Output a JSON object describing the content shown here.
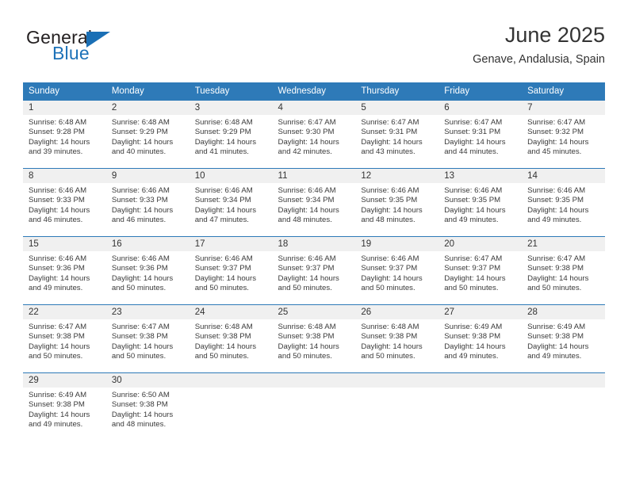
{
  "brand": {
    "name_part1": "General",
    "name_part2": "Blue",
    "accent_color": "#1a6fb5"
  },
  "header": {
    "title": "June 2025",
    "subtitle": "Genave, Andalusia, Spain"
  },
  "theme": {
    "header_blue": "#2e7ab8",
    "daynum_strip": "#f0f0f0",
    "text": "#333333"
  },
  "weekdays": [
    "Sunday",
    "Monday",
    "Tuesday",
    "Wednesday",
    "Thursday",
    "Friday",
    "Saturday"
  ],
  "weeks": [
    [
      {
        "day": "1",
        "sunrise": "Sunrise: 6:48 AM",
        "sunset": "Sunset: 9:28 PM",
        "daylight1": "Daylight: 14 hours",
        "daylight2": "and 39 minutes."
      },
      {
        "day": "2",
        "sunrise": "Sunrise: 6:48 AM",
        "sunset": "Sunset: 9:29 PM",
        "daylight1": "Daylight: 14 hours",
        "daylight2": "and 40 minutes."
      },
      {
        "day": "3",
        "sunrise": "Sunrise: 6:48 AM",
        "sunset": "Sunset: 9:29 PM",
        "daylight1": "Daylight: 14 hours",
        "daylight2": "and 41 minutes."
      },
      {
        "day": "4",
        "sunrise": "Sunrise: 6:47 AM",
        "sunset": "Sunset: 9:30 PM",
        "daylight1": "Daylight: 14 hours",
        "daylight2": "and 42 minutes."
      },
      {
        "day": "5",
        "sunrise": "Sunrise: 6:47 AM",
        "sunset": "Sunset: 9:31 PM",
        "daylight1": "Daylight: 14 hours",
        "daylight2": "and 43 minutes."
      },
      {
        "day": "6",
        "sunrise": "Sunrise: 6:47 AM",
        "sunset": "Sunset: 9:31 PM",
        "daylight1": "Daylight: 14 hours",
        "daylight2": "and 44 minutes."
      },
      {
        "day": "7",
        "sunrise": "Sunrise: 6:47 AM",
        "sunset": "Sunset: 9:32 PM",
        "daylight1": "Daylight: 14 hours",
        "daylight2": "and 45 minutes."
      }
    ],
    [
      {
        "day": "8",
        "sunrise": "Sunrise: 6:46 AM",
        "sunset": "Sunset: 9:33 PM",
        "daylight1": "Daylight: 14 hours",
        "daylight2": "and 46 minutes."
      },
      {
        "day": "9",
        "sunrise": "Sunrise: 6:46 AM",
        "sunset": "Sunset: 9:33 PM",
        "daylight1": "Daylight: 14 hours",
        "daylight2": "and 46 minutes."
      },
      {
        "day": "10",
        "sunrise": "Sunrise: 6:46 AM",
        "sunset": "Sunset: 9:34 PM",
        "daylight1": "Daylight: 14 hours",
        "daylight2": "and 47 minutes."
      },
      {
        "day": "11",
        "sunrise": "Sunrise: 6:46 AM",
        "sunset": "Sunset: 9:34 PM",
        "daylight1": "Daylight: 14 hours",
        "daylight2": "and 48 minutes."
      },
      {
        "day": "12",
        "sunrise": "Sunrise: 6:46 AM",
        "sunset": "Sunset: 9:35 PM",
        "daylight1": "Daylight: 14 hours",
        "daylight2": "and 48 minutes."
      },
      {
        "day": "13",
        "sunrise": "Sunrise: 6:46 AM",
        "sunset": "Sunset: 9:35 PM",
        "daylight1": "Daylight: 14 hours",
        "daylight2": "and 49 minutes."
      },
      {
        "day": "14",
        "sunrise": "Sunrise: 6:46 AM",
        "sunset": "Sunset: 9:35 PM",
        "daylight1": "Daylight: 14 hours",
        "daylight2": "and 49 minutes."
      }
    ],
    [
      {
        "day": "15",
        "sunrise": "Sunrise: 6:46 AM",
        "sunset": "Sunset: 9:36 PM",
        "daylight1": "Daylight: 14 hours",
        "daylight2": "and 49 minutes."
      },
      {
        "day": "16",
        "sunrise": "Sunrise: 6:46 AM",
        "sunset": "Sunset: 9:36 PM",
        "daylight1": "Daylight: 14 hours",
        "daylight2": "and 50 minutes."
      },
      {
        "day": "17",
        "sunrise": "Sunrise: 6:46 AM",
        "sunset": "Sunset: 9:37 PM",
        "daylight1": "Daylight: 14 hours",
        "daylight2": "and 50 minutes."
      },
      {
        "day": "18",
        "sunrise": "Sunrise: 6:46 AM",
        "sunset": "Sunset: 9:37 PM",
        "daylight1": "Daylight: 14 hours",
        "daylight2": "and 50 minutes."
      },
      {
        "day": "19",
        "sunrise": "Sunrise: 6:46 AM",
        "sunset": "Sunset: 9:37 PM",
        "daylight1": "Daylight: 14 hours",
        "daylight2": "and 50 minutes."
      },
      {
        "day": "20",
        "sunrise": "Sunrise: 6:47 AM",
        "sunset": "Sunset: 9:37 PM",
        "daylight1": "Daylight: 14 hours",
        "daylight2": "and 50 minutes."
      },
      {
        "day": "21",
        "sunrise": "Sunrise: 6:47 AM",
        "sunset": "Sunset: 9:38 PM",
        "daylight1": "Daylight: 14 hours",
        "daylight2": "and 50 minutes."
      }
    ],
    [
      {
        "day": "22",
        "sunrise": "Sunrise: 6:47 AM",
        "sunset": "Sunset: 9:38 PM",
        "daylight1": "Daylight: 14 hours",
        "daylight2": "and 50 minutes."
      },
      {
        "day": "23",
        "sunrise": "Sunrise: 6:47 AM",
        "sunset": "Sunset: 9:38 PM",
        "daylight1": "Daylight: 14 hours",
        "daylight2": "and 50 minutes."
      },
      {
        "day": "24",
        "sunrise": "Sunrise: 6:48 AM",
        "sunset": "Sunset: 9:38 PM",
        "daylight1": "Daylight: 14 hours",
        "daylight2": "and 50 minutes."
      },
      {
        "day": "25",
        "sunrise": "Sunrise: 6:48 AM",
        "sunset": "Sunset: 9:38 PM",
        "daylight1": "Daylight: 14 hours",
        "daylight2": "and 50 minutes."
      },
      {
        "day": "26",
        "sunrise": "Sunrise: 6:48 AM",
        "sunset": "Sunset: 9:38 PM",
        "daylight1": "Daylight: 14 hours",
        "daylight2": "and 50 minutes."
      },
      {
        "day": "27",
        "sunrise": "Sunrise: 6:49 AM",
        "sunset": "Sunset: 9:38 PM",
        "daylight1": "Daylight: 14 hours",
        "daylight2": "and 49 minutes."
      },
      {
        "day": "28",
        "sunrise": "Sunrise: 6:49 AM",
        "sunset": "Sunset: 9:38 PM",
        "daylight1": "Daylight: 14 hours",
        "daylight2": "and 49 minutes."
      }
    ],
    [
      {
        "day": "29",
        "sunrise": "Sunrise: 6:49 AM",
        "sunset": "Sunset: 9:38 PM",
        "daylight1": "Daylight: 14 hours",
        "daylight2": "and 49 minutes."
      },
      {
        "day": "30",
        "sunrise": "Sunrise: 6:50 AM",
        "sunset": "Sunset: 9:38 PM",
        "daylight1": "Daylight: 14 hours",
        "daylight2": "and 48 minutes."
      },
      {
        "day": "",
        "sunrise": "",
        "sunset": "",
        "daylight1": "",
        "daylight2": ""
      },
      {
        "day": "",
        "sunrise": "",
        "sunset": "",
        "daylight1": "",
        "daylight2": ""
      },
      {
        "day": "",
        "sunrise": "",
        "sunset": "",
        "daylight1": "",
        "daylight2": ""
      },
      {
        "day": "",
        "sunrise": "",
        "sunset": "",
        "daylight1": "",
        "daylight2": ""
      },
      {
        "day": "",
        "sunrise": "",
        "sunset": "",
        "daylight1": "",
        "daylight2": ""
      }
    ]
  ]
}
